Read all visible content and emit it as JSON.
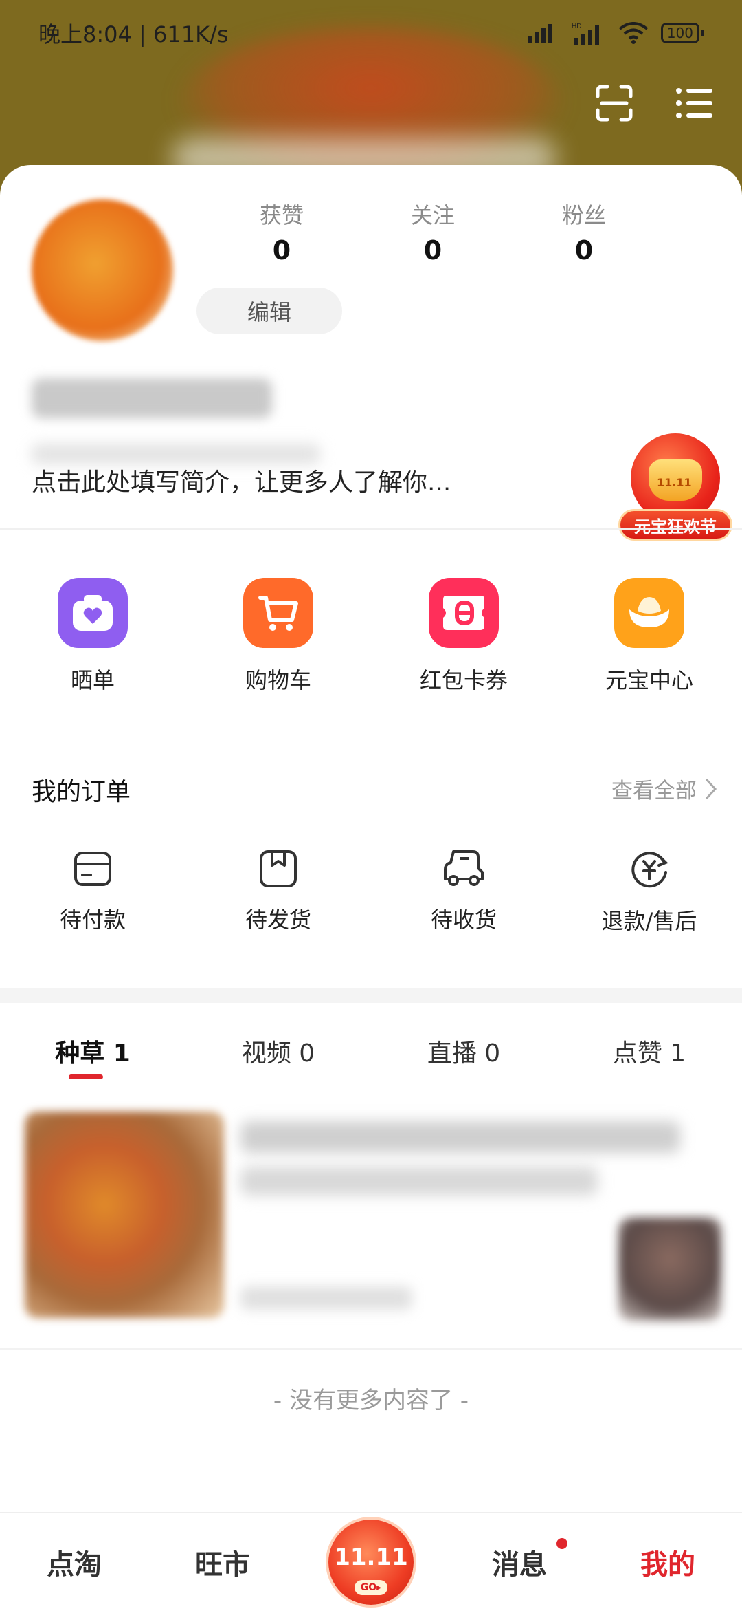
{
  "status_bar": {
    "time_speed": "晚上8:04 | 611K/s",
    "battery": "100"
  },
  "stats": [
    {
      "label": "获赞",
      "value": "0"
    },
    {
      "label": "关注",
      "value": "0"
    },
    {
      "label": "粉丝",
      "value": "0"
    }
  ],
  "profile": {
    "edit_label": "编辑",
    "bio_placeholder": "点击此处填写简介，让更多人了解你..."
  },
  "promo": {
    "ingot_text": "11.11",
    "label": "元宝狂欢节"
  },
  "shortcuts": [
    {
      "label": "晒单",
      "icon": "camera-heart-icon",
      "color": "#8f5ef0"
    },
    {
      "label": "购物车",
      "icon": "cart-icon",
      "color": "#ff6a2a"
    },
    {
      "label": "红包卡券",
      "icon": "coupon-icon",
      "color": "#ff2f5a"
    },
    {
      "label": "元宝中心",
      "icon": "ingot-icon",
      "color": "#ffa21a"
    }
  ],
  "orders": {
    "title": "我的订单",
    "view_all": "查看全部",
    "items": [
      {
        "label": "待付款",
        "icon": "wallet-icon"
      },
      {
        "label": "待发货",
        "icon": "box-icon"
      },
      {
        "label": "待收货",
        "icon": "truck-icon"
      },
      {
        "label": "退款/售后",
        "icon": "refund-icon"
      }
    ]
  },
  "tabs": [
    {
      "label": "种草 1",
      "active": true
    },
    {
      "label": "视频 0",
      "active": false
    },
    {
      "label": "直播 0",
      "active": false
    },
    {
      "label": "点赞 1",
      "active": false
    }
  ],
  "feed": {
    "end_text": "- 没有更多内容了 -"
  },
  "bottom_nav": [
    {
      "label": "点淘",
      "active": false
    },
    {
      "label": "旺市",
      "active": false
    },
    {
      "center_text": "11.11",
      "go_text": "GO▸"
    },
    {
      "label": "消息",
      "active": false,
      "badge": true
    },
    {
      "label": "我的",
      "active": true
    }
  ],
  "colors": {
    "accent": "#e0262d",
    "header_bg": "#7e6a1f"
  }
}
